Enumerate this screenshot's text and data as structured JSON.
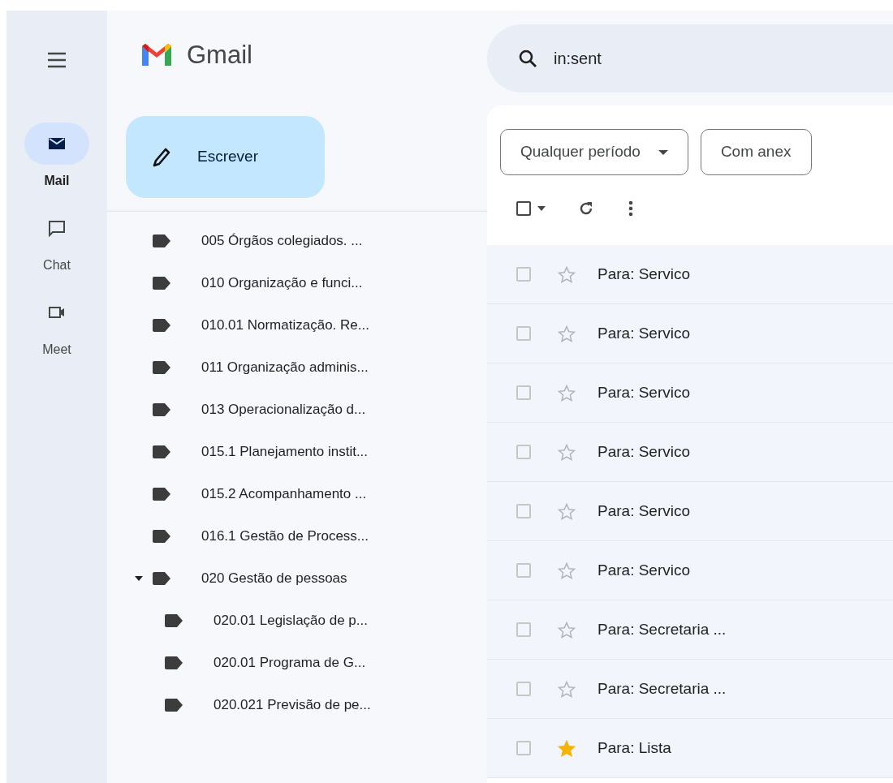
{
  "rail": {
    "items": [
      {
        "kind": "mail",
        "label": "Mail",
        "selected": true
      },
      {
        "kind": "chat",
        "label": "Chat",
        "selected": false
      },
      {
        "kind": "meet",
        "label": "Meet",
        "selected": false
      }
    ]
  },
  "app": {
    "name": "Gmail"
  },
  "compose": {
    "label": "Escrever"
  },
  "search": {
    "value": "in:sent"
  },
  "labels": [
    {
      "name": "005 Órgãos colegiados. ...",
      "expanded": false
    },
    {
      "name": "010 Organização e funci...",
      "expanded": false
    },
    {
      "name": "010.01 Normatização. Re...",
      "expanded": false
    },
    {
      "name": "011 Organização adminis...",
      "expanded": false
    },
    {
      "name": "013 Operacionalização d...",
      "expanded": false
    },
    {
      "name": "015.1 Planejamento instit...",
      "expanded": false
    },
    {
      "name": "015.2 Acompanhamento ...",
      "expanded": false
    },
    {
      "name": "016.1 Gestão de Process...",
      "expanded": false
    },
    {
      "name": "020 Gestão de pessoas",
      "expanded": true,
      "children": [
        {
          "name": "020.01 Legislação de p...",
          "expanded": false
        },
        {
          "name": "020.01 Programa de G...",
          "expanded": false
        },
        {
          "name": "020.021 Previsão de pe...",
          "expanded": false
        }
      ]
    }
  ],
  "filters": [
    {
      "kind": "dropdown",
      "label": "Qualquer período"
    },
    {
      "kind": "toggle",
      "label": "Com anex"
    }
  ],
  "select_all": {
    "checked": false
  },
  "emails": [
    {
      "to": "Para: Servico",
      "checked": false,
      "starred": false
    },
    {
      "to": "Para: Servico",
      "checked": false,
      "starred": false
    },
    {
      "to": "Para: Servico",
      "checked": false,
      "starred": false
    },
    {
      "to": "Para: Servico",
      "checked": false,
      "starred": false
    },
    {
      "to": "Para: Servico",
      "checked": false,
      "starred": false
    },
    {
      "to": "Para: Servico",
      "checked": false,
      "starred": false
    },
    {
      "to": "Para: Secretaria ...",
      "checked": false,
      "starred": false
    },
    {
      "to": "Para: Secretaria ...",
      "checked": false,
      "starred": false
    },
    {
      "to": "Para: Lista",
      "checked": false,
      "starred": true
    }
  ]
}
